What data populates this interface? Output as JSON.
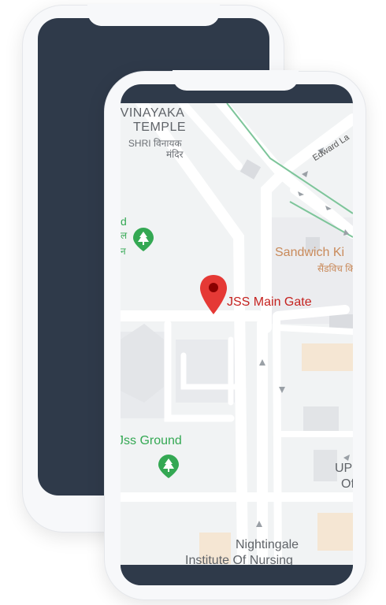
{
  "map": {
    "places": {
      "temple": {
        "line1": "VINAYAKA",
        "line2": "TEMPLE"
      },
      "temple_hi": {
        "line1": "SHRI विनायक",
        "line2": "मंदिर"
      },
      "sandwich": {
        "name": "Sandwich Ki",
        "name_hi": "सैंडविच कि"
      },
      "jss_main_gate": "JSS Main Gate",
      "jss_ground": "Jss Ground",
      "edward": "Edward La",
      "up": "UP",
      "of": "Of",
      "nightingale": "Nightingale",
      "institute": "Institute Of Nursing",
      "park_fragment": {
        "line1": "d",
        "line2": "ल",
        "line3": "न"
      }
    },
    "icons": {
      "park": "park-tree-icon",
      "pin": "location-pin-icon"
    },
    "colors": {
      "pin": "#e53935",
      "park": "#34a853",
      "road": "#ffffff",
      "green_line": "#7dc59a",
      "building_tan": "#f5e6d3"
    }
  }
}
